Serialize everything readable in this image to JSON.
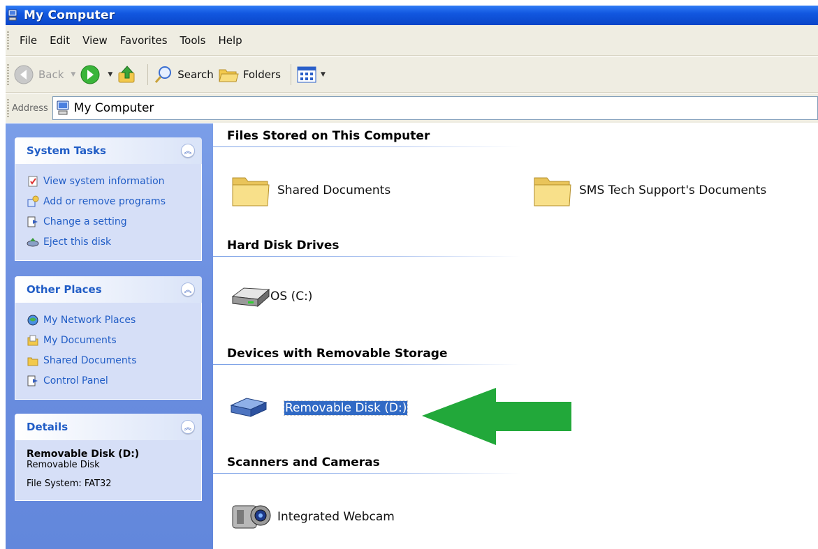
{
  "window": {
    "title": "My Computer"
  },
  "menu": [
    "File",
    "Edit",
    "View",
    "Favorites",
    "Tools",
    "Help"
  ],
  "toolbar": {
    "back_label": "Back",
    "search_label": "Search",
    "folders_label": "Folders"
  },
  "address": {
    "label": "Address",
    "value": "My Computer"
  },
  "left_pane": {
    "system_tasks": {
      "title": "System Tasks",
      "items": [
        "View system information",
        "Add or remove programs",
        "Change a setting",
        "Eject this disk"
      ]
    },
    "other_places": {
      "title": "Other Places",
      "items": [
        "My Network Places",
        "My Documents",
        "Shared Documents",
        "Control Panel"
      ]
    },
    "details": {
      "title": "Details",
      "name": "Removable Disk (D:)",
      "type": "Removable Disk",
      "file_system": "File System: FAT32"
    }
  },
  "sections": {
    "files_stored": {
      "title": "Files Stored on This Computer",
      "items": [
        "Shared Documents",
        "SMS Tech Support's Documents"
      ]
    },
    "hard_disks": {
      "title": "Hard Disk Drives",
      "items": [
        "OS (C:)"
      ]
    },
    "removable": {
      "title": "Devices with Removable Storage",
      "items": [
        "Removable Disk (D:)"
      ]
    },
    "scanners": {
      "title": "Scanners and Cameras",
      "items": [
        "Integrated Webcam"
      ]
    }
  },
  "colors": {
    "titlebar": "#0a46c8",
    "task_link": "#215dc6",
    "selection": "#316ac5",
    "arrow": "#22a83a"
  }
}
